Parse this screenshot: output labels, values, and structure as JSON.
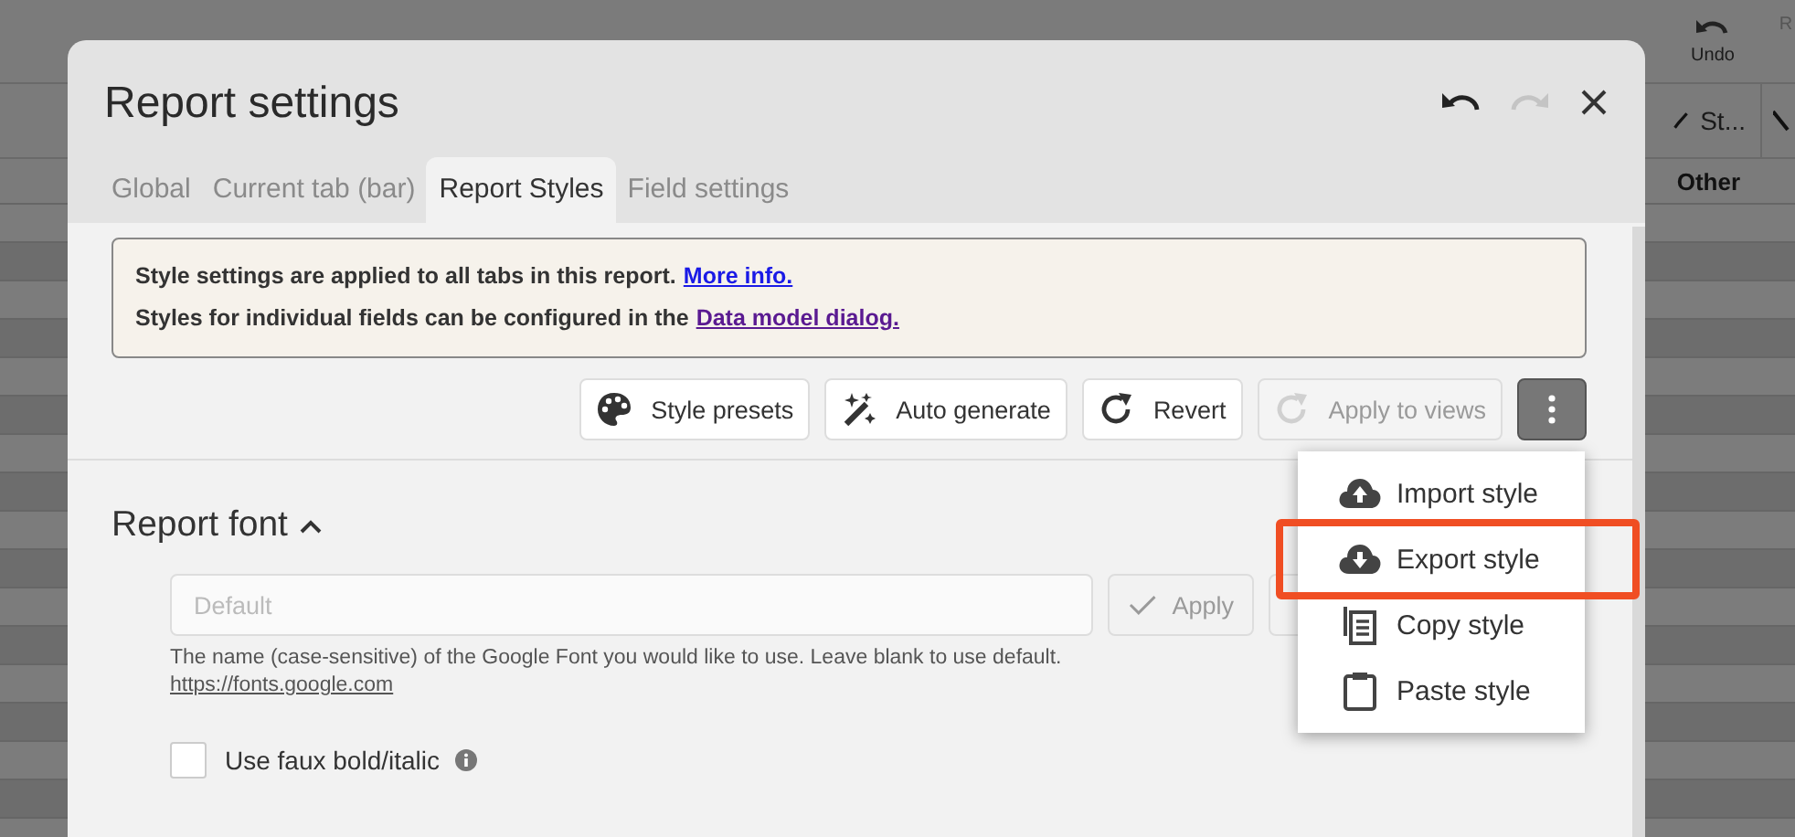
{
  "background_app": {
    "toolbar": [
      {
        "label": "Undo",
        "disabled": false
      },
      {
        "label": "R",
        "disabled": true
      }
    ],
    "style_button": "St...",
    "column_header": "Other"
  },
  "dialog": {
    "title": "Report settings",
    "undo_disabled": false,
    "redo_disabled": true
  },
  "tabs": [
    {
      "label": "Global",
      "selected": false
    },
    {
      "label": "Current tab (bar)",
      "selected": false
    },
    {
      "label": "Report Styles",
      "selected": true
    },
    {
      "label": "Field settings",
      "selected": false
    }
  ],
  "notice": [
    {
      "text": "Style settings are applied to all tabs in this report.",
      "link": "More info.",
      "visited": false
    },
    {
      "text": "Styles for individual fields can be configured in the",
      "link": "Data model dialog.",
      "visited": true
    }
  ],
  "actions": [
    {
      "label": "Style presets",
      "disabled": false
    },
    {
      "label": "Auto generate",
      "disabled": false
    },
    {
      "label": "Revert",
      "disabled": false
    },
    {
      "label": "Apply to views",
      "disabled": true
    }
  ],
  "more_button": {
    "expanded": true
  },
  "menu": [
    {
      "label": "Import style",
      "highlighted": false
    },
    {
      "label": "Export style",
      "highlighted": true
    },
    {
      "label": "Copy style",
      "highlighted": false
    },
    {
      "label": "Paste style",
      "highlighted": false
    }
  ],
  "font_section": {
    "title": "Report font",
    "expanded": true,
    "placeholder": "Default",
    "apply": {
      "label": "Apply",
      "disabled": true
    },
    "help": "The name (case-sensitive) of the Google Font you would like to use. Leave blank to use default.",
    "link": "https://fonts.google.com",
    "faux": {
      "label": "Use faux bold/italic",
      "checked": false
    }
  }
}
